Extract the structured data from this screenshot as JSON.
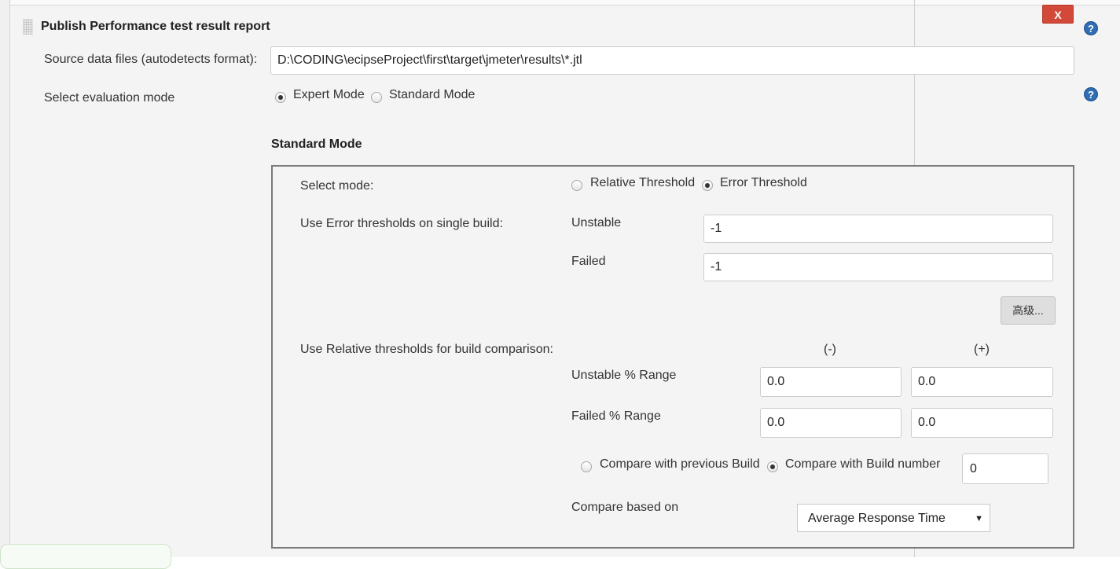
{
  "section": {
    "title": "Publish Performance test result report",
    "close_label": "X",
    "help_symbol": "?"
  },
  "source": {
    "label": "Source data files (autodetects format):",
    "value": "D:\\CODING\\ecipseProject\\first\\target\\jmeter\\results\\*.jtl"
  },
  "evaluation": {
    "label": "Select evaluation mode",
    "options": [
      "Expert Mode",
      "Standard Mode"
    ],
    "selected": "Expert Mode"
  },
  "standard_mode": {
    "heading": "Standard Mode",
    "select_mode": {
      "label": "Select mode:",
      "options": [
        "Relative Threshold",
        "Error Threshold"
      ],
      "selected": "Error Threshold"
    },
    "error_thresholds": {
      "label": "Use Error thresholds on single build:",
      "unstable_label": "Unstable",
      "unstable_value": "-1",
      "failed_label": "Failed",
      "failed_value": "-1"
    },
    "advanced_label": "高级...",
    "relative_thresholds": {
      "label": "Use Relative thresholds for build comparison:",
      "minus_header": "(-)",
      "plus_header": "(+)",
      "unstable_label": "Unstable % Range",
      "unstable_minus": "0.0",
      "unstable_plus": "0.0",
      "failed_label": "Failed % Range",
      "failed_minus": "0.0",
      "failed_plus": "0.0"
    },
    "compare": {
      "options": [
        "Compare with previous Build",
        "Compare with Build number"
      ],
      "selected": "Compare with Build number",
      "build_number": "0"
    },
    "compare_based_on": {
      "label": "Compare based on",
      "selected": "Average Response Time"
    }
  }
}
